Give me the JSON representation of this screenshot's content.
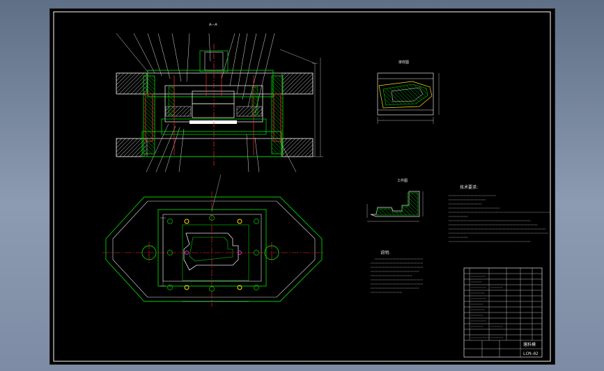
{
  "colors": {
    "background_outer": "#7d8ca4",
    "canvas": "#000000",
    "frame": "#ffffff",
    "outline": "#e6e6e6",
    "green": "#00d000",
    "red": "#ff2a2a",
    "yellow": "#ffe000",
    "magenta": "#ff40ff"
  },
  "section_view": {
    "title": "A—A"
  },
  "detail_view": {
    "title": "排样图"
  },
  "workpiece_view": {
    "title": "工件图"
  },
  "notes_title": "说明:",
  "tech_title": "技术要求:",
  "title_block": {
    "drawing_name": "落料模",
    "drawing_code": "LCM—02"
  }
}
